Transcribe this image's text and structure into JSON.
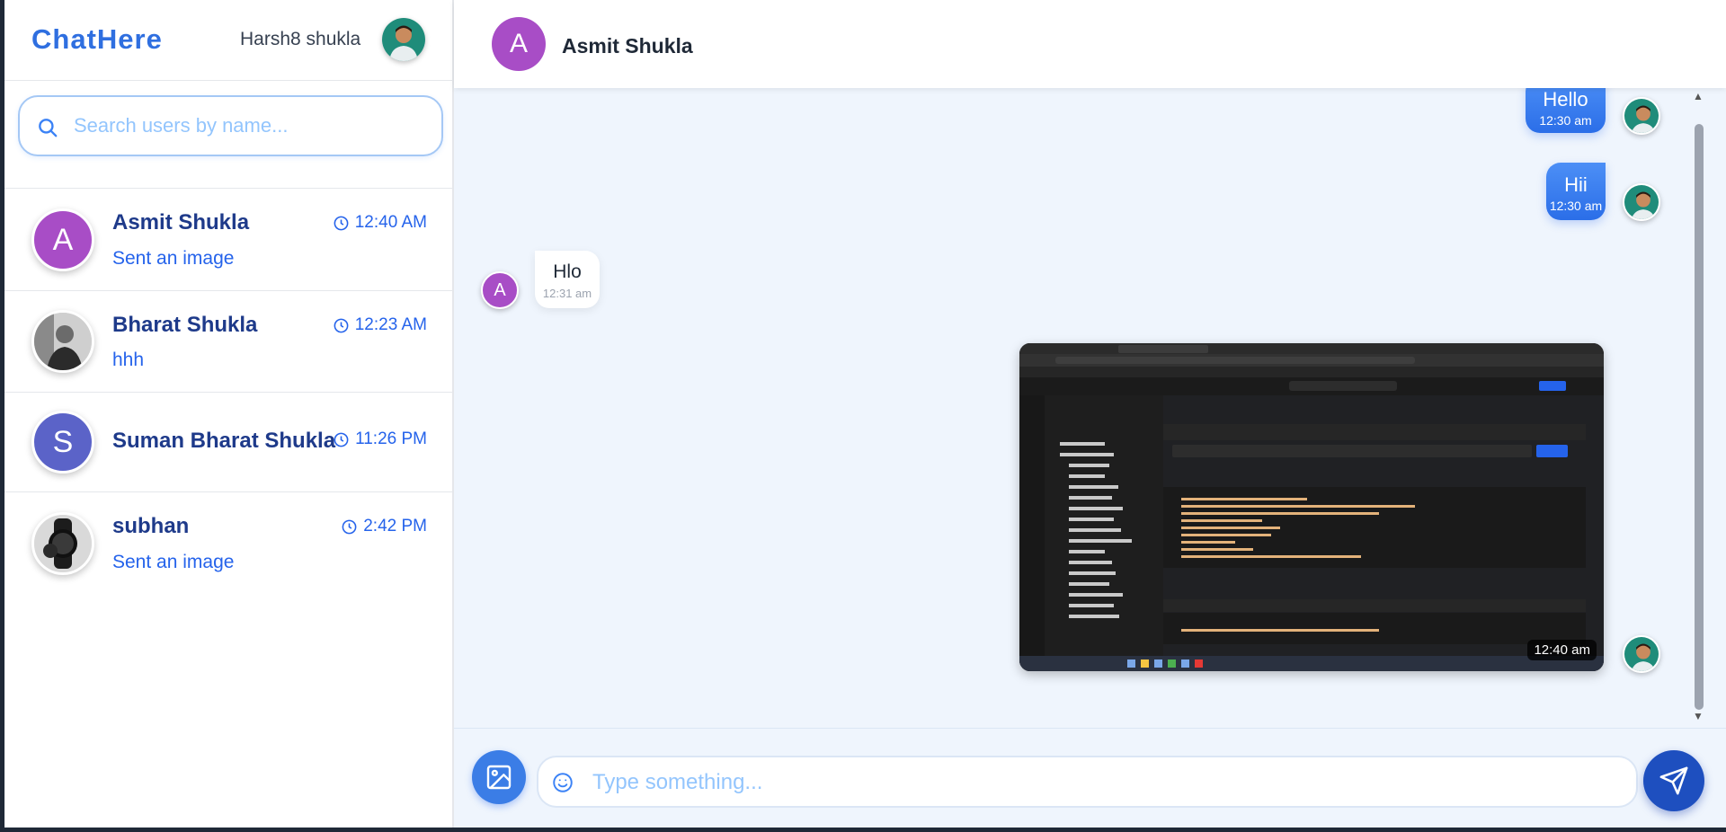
{
  "app": {
    "brand": "ChatHere"
  },
  "current_user": {
    "name": "Harsh8 shukla"
  },
  "search": {
    "placeholder": "Search users by name..."
  },
  "conversations": [
    {
      "initial": "A",
      "name": "Asmit Shukla",
      "time": "12:40 AM",
      "preview": "Sent an image",
      "avatar_color": "#a84dc6"
    },
    {
      "initial": "",
      "name": "Bharat Shukla",
      "time": "12:23 AM",
      "preview": "hhh",
      "avatar_color": "#4b5563"
    },
    {
      "initial": "S",
      "name": "Suman Bharat Shukla",
      "time": "11:26 PM",
      "preview": "",
      "avatar_color": "#5b63c8"
    },
    {
      "initial": "",
      "name": "subhan",
      "time": "2:42 PM",
      "preview": "Sent an image",
      "avatar_color": "#d1d5db"
    }
  ],
  "chat": {
    "contact_initial": "A",
    "contact_name": "Asmit Shukla",
    "messages": [
      {
        "direction": "out",
        "text": "Hello",
        "time": "12:30 am"
      },
      {
        "direction": "out",
        "text": "Hii",
        "time": "12:30 am"
      },
      {
        "direction": "in",
        "text": "Hlo",
        "time": "12:31 am",
        "initial": "A"
      },
      {
        "direction": "out",
        "type": "image",
        "time": "12:40 am"
      }
    ]
  },
  "composer": {
    "placeholder": "Type something..."
  },
  "colors": {
    "accent": "#2f6fe0",
    "outgoing_bubble": "#3b7de6",
    "contact_avatar": "#a84dc6",
    "chat_bg": "#eff5fd"
  }
}
